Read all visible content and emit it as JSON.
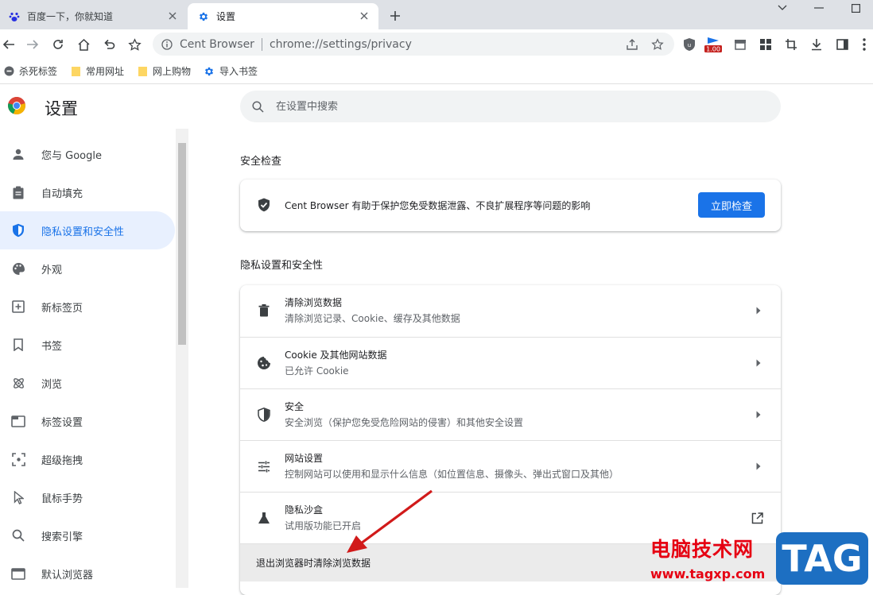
{
  "tabs": [
    {
      "label": "百度一下，你就知道"
    },
    {
      "label": "设置"
    }
  ],
  "omnibox": {
    "brand": "Cent Browser",
    "url": "chrome://settings/privacy"
  },
  "extension_badge": "1.00",
  "bookmarks": [
    {
      "label": "杀死标签",
      "icon": "kill-icon"
    },
    {
      "label": "常用网址",
      "icon": "folder-icon"
    },
    {
      "label": "网上购物",
      "icon": "folder-icon"
    },
    {
      "label": "导入书签",
      "icon": "gear-icon"
    }
  ],
  "header": {
    "title": "设置"
  },
  "search": {
    "placeholder": "在设置中搜索"
  },
  "sidebar": {
    "items": [
      {
        "label": "您与 Google",
        "icon": "person-icon"
      },
      {
        "label": "自动填充",
        "icon": "clipboard-icon"
      },
      {
        "label": "隐私设置和安全性",
        "icon": "shield-icon"
      },
      {
        "label": "外观",
        "icon": "palette-icon"
      },
      {
        "label": "新标签页",
        "icon": "new-tab-icon"
      },
      {
        "label": "书签",
        "icon": "bookmark-icon"
      },
      {
        "label": "浏览",
        "icon": "atom-icon"
      },
      {
        "label": "标签设置",
        "icon": "tab-icon"
      },
      {
        "label": "超级拖拽",
        "icon": "drag-icon"
      },
      {
        "label": "鼠标手势",
        "icon": "cursor-icon"
      },
      {
        "label": "搜索引擎",
        "icon": "search-icon"
      },
      {
        "label": "默认浏览器",
        "icon": "browser-icon"
      }
    ]
  },
  "safety_check": {
    "title": "安全检查",
    "description": "Cent Browser 有助于保护您免受数据泄露、不良扩展程序等问题的影响",
    "button": "立即检查"
  },
  "privacy": {
    "title": "隐私设置和安全性",
    "rows": [
      {
        "title": "清除浏览数据",
        "subtitle": "清除浏览记录、Cookie、缓存及其他数据",
        "icon": "trash-icon"
      },
      {
        "title": "Cookie 及其他网站数据",
        "subtitle": "已允许 Cookie",
        "icon": "cookie-icon"
      },
      {
        "title": "安全",
        "subtitle": "安全浏览（保护您免受危险网站的侵害）和其他安全设置",
        "icon": "shield-icon"
      },
      {
        "title": "网站设置",
        "subtitle": "控制网站可以使用和显示什么信息（如位置信息、摄像头、弹出式窗口及其他）",
        "icon": "tune-icon"
      },
      {
        "title": "隐私沙盒",
        "subtitle": "试用版功能已开启",
        "icon": "flask-icon"
      }
    ],
    "subrow": "退出浏览器时清除浏览数据"
  },
  "watermark": {
    "text": "电脑技术网",
    "url": "www.tagxp.com",
    "tag": "TAG"
  },
  "colors": {
    "accent": "#1a73e8",
    "watermark_red": "#e60012",
    "tag_blue": "#1d6fc2"
  }
}
